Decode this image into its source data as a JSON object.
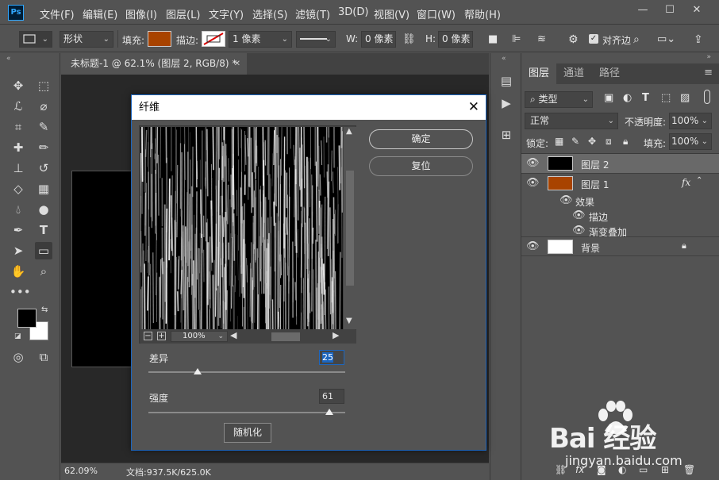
{
  "app": {
    "logo": "Ps"
  },
  "menu": [
    "文件(F)",
    "编辑(E)",
    "图像(I)",
    "图层(L)",
    "文字(Y)",
    "选择(S)",
    "滤镜(T)",
    "3D(D)",
    "视图(V)",
    "窗口(W)",
    "帮助(H)"
  ],
  "window_controls": {
    "minimize": "—",
    "maximize": "☐",
    "close": "✕"
  },
  "options": {
    "mode": "形状",
    "fill_label": "填充:",
    "fill_color": "#a84300",
    "stroke_label": "描边:",
    "stroke_width": "1 像素",
    "w_label": "W:",
    "w_value": "0 像素",
    "h_label": "H:",
    "h_value": "0 像素",
    "align_edges": "对齐边"
  },
  "document": {
    "tab_title": "未标题-1 @ 62.1% (图层 2, RGB/8) *",
    "tab_close": "✕",
    "zoom": "62.09%",
    "doc_info": "文档:937.5K/625.0K"
  },
  "colors": {
    "foreground": "#000000",
    "background": "#ffffff",
    "fill_accent": "#a84300"
  },
  "layers_panel": {
    "tabs": [
      "图层",
      "通道",
      "路径"
    ],
    "filter_kind": "类型",
    "blend_mode": "正常",
    "opacity_label": "不透明度:",
    "opacity_value": "100%",
    "lock_label": "锁定:",
    "fill_label": "填充:",
    "fill_value": "100%",
    "layers": [
      {
        "name": "图层 2",
        "thumb": "#000000",
        "selected": true
      },
      {
        "name": "图层 1",
        "thumb": "#a84300",
        "fx": "fx",
        "effects_label": "效果",
        "effects": [
          "描边",
          "渐变叠加"
        ]
      },
      {
        "name": "背景",
        "thumb": "#ffffff",
        "locked": true
      }
    ]
  },
  "dialog": {
    "title": "纤维",
    "close": "✕",
    "ok": "确定",
    "reset": "复位",
    "preview_zoom": "100%",
    "variance_label": "差异",
    "variance_value": "25",
    "variance_fraction": 0.25,
    "strength_label": "强度",
    "strength_value": "61",
    "strength_fraction": 0.92,
    "randomize": "随机化"
  },
  "watermark": {
    "brand": "Bai 经验",
    "url": "jingyan.baidu.com"
  },
  "icons": {
    "tools": [
      "move-icon",
      "marquee-icon",
      "lasso-icon",
      "quick-select-icon",
      "crop-icon",
      "eyedropper-icon",
      "healing-brush-icon",
      "brush-icon",
      "stamp-icon",
      "history-brush-icon",
      "eraser-icon",
      "gradient-icon",
      "blur-icon",
      "dodge-icon",
      "pen-icon",
      "type-icon",
      "path-select-icon",
      "rectangle-icon",
      "hand-icon",
      "zoom-icon",
      "more-tools-icon"
    ]
  }
}
